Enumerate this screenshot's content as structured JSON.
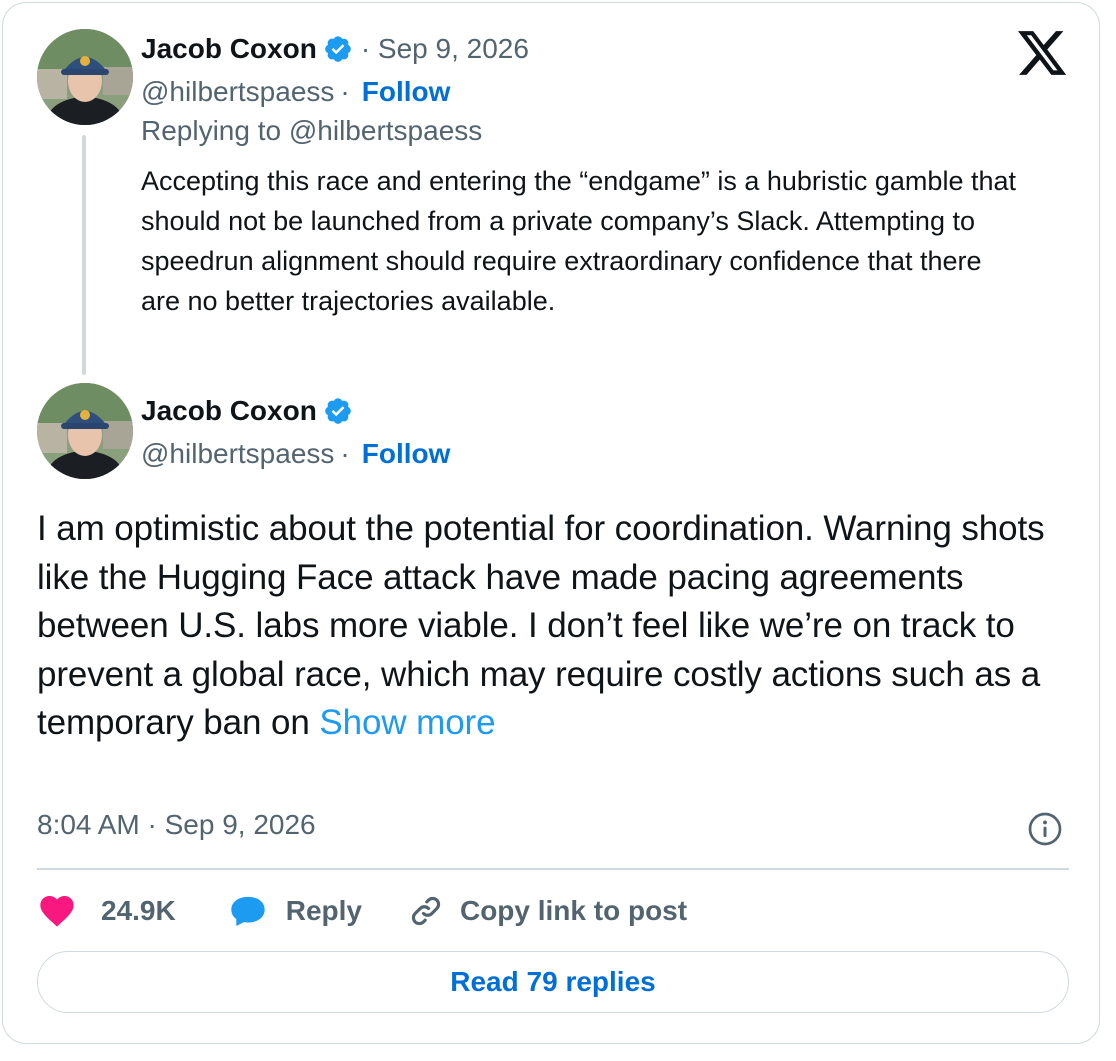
{
  "colors": {
    "accent": "#006fd6",
    "link": "#1d9bf0",
    "verified": "#1d9bf0",
    "like": "#f91880",
    "muted": "#536471",
    "text": "#0f1419",
    "border": "#cfd9de"
  },
  "quoted_post": {
    "author_name": "Jacob Coxon",
    "date": "· Sep 9, 2026",
    "handle": "@hilbertspaess",
    "separator": "·",
    "follow_label": "Follow",
    "replying_to": "Replying to @hilbertspaess",
    "text": "Accepting this race and entering the “endgame” is a hubristic gamble that should not be launched from a private company’s Slack. Attempting to speedrun alignment should require extraordinary confidence that there are no better trajectories available."
  },
  "main_post": {
    "author_name": "Jacob Coxon",
    "handle": "@hilbertspaess",
    "separator": "·",
    "follow_label": "Follow",
    "text": "I am optimistic about the potential for coordination. Warning shots like the Hugging Face attack have made pacing agreements between U.S. labs more viable. I don’t feel like we’re on track to prevent a global race, which may require costly actions such as a temporary ban on ",
    "show_more_label": "Show more",
    "timestamp": "8:04 AM · Sep 9, 2026"
  },
  "actions": {
    "like_count": "24.9K",
    "reply_label": "Reply",
    "copy_link_label": "Copy link to post"
  },
  "read_replies_label": "Read 79 replies",
  "icons": {
    "brand": "x-logo-icon",
    "verified": "verified-badge-icon",
    "like": "heart-icon",
    "reply": "speech-bubble-icon",
    "copy_link": "link-icon",
    "info": "info-icon"
  }
}
